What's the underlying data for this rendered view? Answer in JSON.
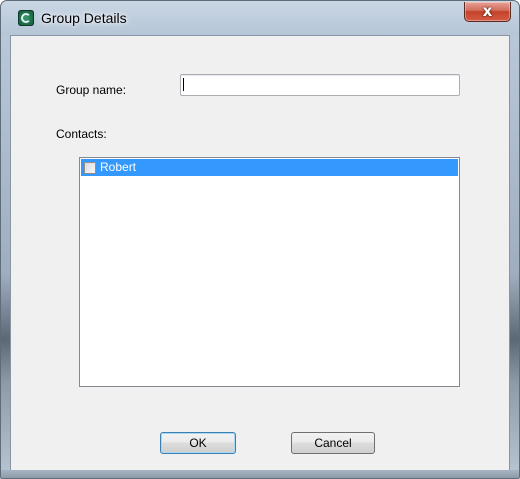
{
  "window": {
    "title": "Group Details",
    "app_icon": "app-logo-icon",
    "close_icon": "close-icon",
    "close_glyph": "x"
  },
  "form": {
    "group_name_label": "Group name:",
    "group_name_value": "",
    "contacts_label": "Contacts:"
  },
  "contacts": [
    {
      "name": "Robert",
      "checked": false,
      "selected": true
    }
  ],
  "buttons": {
    "ok_label": "OK",
    "cancel_label": "Cancel"
  },
  "colors": {
    "selection": "#3399ff",
    "close_button": "#c2422b"
  }
}
